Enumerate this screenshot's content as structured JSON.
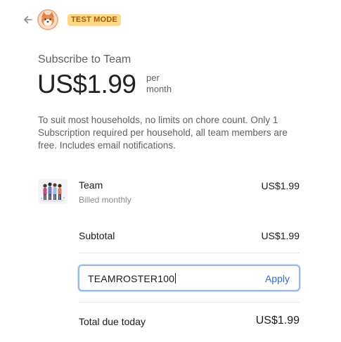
{
  "header": {
    "back_icon": "arrow-left-icon",
    "logo_icon": "shiba-dog-logo",
    "test_mode_badge": "TEST MODE"
  },
  "summary": {
    "subscribe_label": "Subscribe to Team",
    "price": "US$1.99",
    "period_line1": "per",
    "period_line2": "month",
    "description": "To suit most households, no limits on chore count. Only 1 Subscription required per household, all team members are free. Includes email notifications."
  },
  "line_item": {
    "name": "Team",
    "billing": "Billed monthly",
    "price": "US$1.99",
    "thumbnail_icon": "team-people-icon"
  },
  "subtotal": {
    "label": "Subtotal",
    "value": "US$1.99"
  },
  "promo": {
    "value": "TEAMROSTER100",
    "apply_label": "Apply"
  },
  "total": {
    "label": "Total due today",
    "value": "US$1.99"
  },
  "colors": {
    "badge_bg": "#fcd98a",
    "badge_text": "#a15c07",
    "link": "#2f6ad9",
    "input_focus_border": "#98b8e8"
  }
}
